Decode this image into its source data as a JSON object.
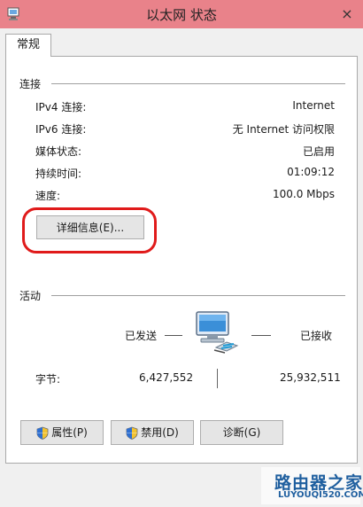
{
  "window": {
    "title": "以太网 状态",
    "close_glyph": "×"
  },
  "tabs": [
    {
      "label": "常规"
    }
  ],
  "connection": {
    "group_label": "连接",
    "rows": [
      {
        "label": "IPv4 连接:",
        "value": "Internet"
      },
      {
        "label": "IPv6 连接:",
        "value": "无 Internet 访问权限"
      },
      {
        "label": "媒体状态:",
        "value": "已启用"
      },
      {
        "label": "持续时间:",
        "value": "01:09:12"
      },
      {
        "label": "速度:",
        "value": "100.0 Mbps"
      }
    ],
    "details_button": "详细信息(E)..."
  },
  "activity": {
    "group_label": "活动",
    "sent_label": "已发送",
    "received_label": "已接收",
    "bytes_label": "字节:",
    "bytes_sent": "6,427,552",
    "bytes_received": "25,932,511"
  },
  "buttons": {
    "properties": "属性(P)",
    "disable": "禁用(D)",
    "diagnose": "诊断(G)"
  },
  "watermark": {
    "brand": "路由器之家",
    "url": "LUYOUQI520.COM"
  },
  "colors": {
    "titlebar": "#e9828a",
    "highlight": "#e01a1a",
    "watermark": "#1f5f9f"
  }
}
